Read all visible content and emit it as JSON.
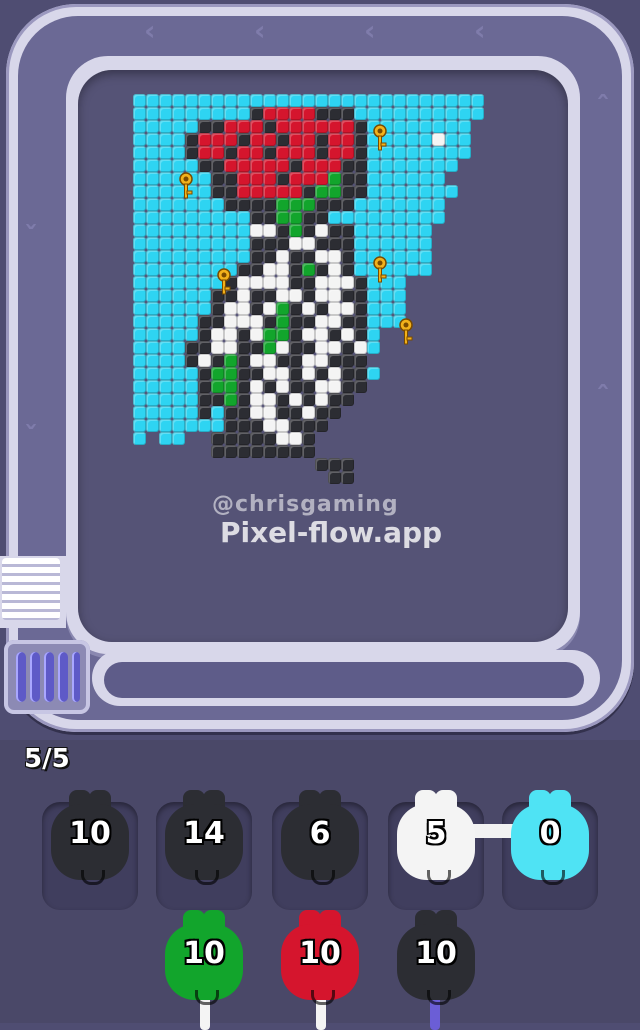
{
  "watermark": {
    "handle": "@chrisgaming",
    "site": "Pixel-flow.app"
  },
  "progress": {
    "label": "5/5"
  },
  "colors": {
    "cyan": "#2ed4f2",
    "black": "#2c2d33",
    "red": "#d5152d",
    "green": "#12a52c",
    "white": "#f4f4f4",
    "track": "#d8d7ea",
    "board": "#555376"
  },
  "keys": {
    "count": 5,
    "icon": "key-icon"
  },
  "shooters_row1": [
    {
      "color": "black",
      "count": "10"
    },
    {
      "color": "black",
      "count": "14"
    },
    {
      "color": "black",
      "count": "6"
    },
    {
      "color": "white",
      "count": "5",
      "linked": true
    },
    {
      "color": "cyan",
      "count": "0",
      "linked": true
    }
  ],
  "shooters_row2": [
    {
      "color": "green",
      "count": "10"
    },
    {
      "color": "red",
      "count": "10"
    },
    {
      "color": "black",
      "count": "10"
    }
  ]
}
